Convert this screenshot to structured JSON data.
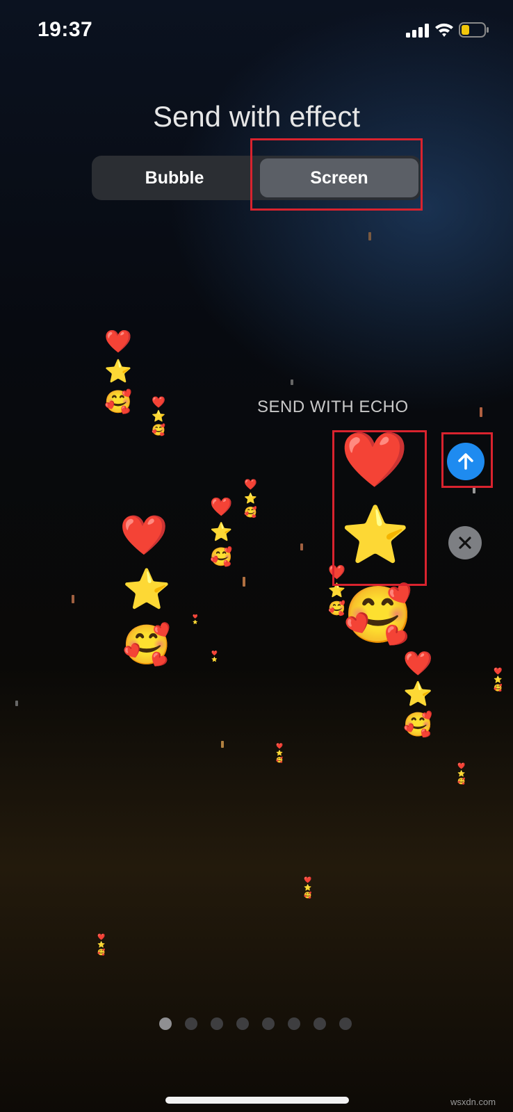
{
  "status_bar": {
    "time": "19:37",
    "icons": [
      "signal-icon",
      "wifi-icon",
      "battery-icon"
    ],
    "battery_color": "#f2c70a"
  },
  "title": "Send with effect",
  "segmented_control": {
    "options": [
      "Bubble",
      "Screen"
    ],
    "selected": "Screen"
  },
  "effect": {
    "name": "SEND WITH ECHO",
    "emojis": [
      "❤️",
      "⭐",
      "🥰"
    ]
  },
  "actions": {
    "send_icon": "arrow-up-icon",
    "close_icon": "close-icon",
    "send_color": "#1e8bf0"
  },
  "pager": {
    "pages": 8,
    "active_page": 1
  },
  "watermark": "wsxdn.com",
  "highlight_color": "#d9232e"
}
